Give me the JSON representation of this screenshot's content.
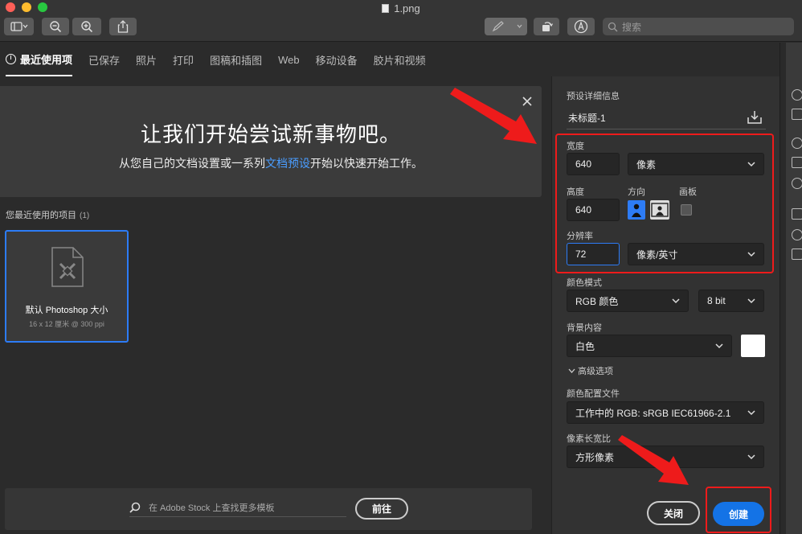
{
  "window": {
    "filename": "1.png"
  },
  "toolbar": {
    "search_placeholder": "搜索"
  },
  "tabs": [
    {
      "label": "最近使用项",
      "active": true
    },
    {
      "label": "已保存"
    },
    {
      "label": "照片"
    },
    {
      "label": "打印"
    },
    {
      "label": "图稿和插图"
    },
    {
      "label": "Web"
    },
    {
      "label": "移动设备"
    },
    {
      "label": "胶片和视频"
    }
  ],
  "hero": {
    "title": "让我们开始尝试新事物吧。",
    "sub_before": "从您自己的文档设置或一系列",
    "sub_link": "文档预设",
    "sub_after": "开始以快速开始工作。"
  },
  "recent": {
    "label": "您最近使用的项目",
    "count": "(1)",
    "items": [
      {
        "name": "默认 Photoshop 大小",
        "desc": "16 x 12 厘米 @ 300 ppi"
      }
    ]
  },
  "stock": {
    "placeholder": "在 Adobe Stock 上查找更多模板",
    "go_label": "前往"
  },
  "preset": {
    "section_label": "预设详细信息",
    "doc_title": "未标题-1",
    "width_label": "宽度",
    "width_value": "640",
    "width_unit": "像素",
    "height_label": "高度",
    "height_value": "640",
    "orientation_label": "方向",
    "artboard_label": "画板",
    "resolution_label": "分辨率",
    "resolution_value": "72",
    "resolution_unit": "像素/英寸",
    "color_mode_label": "颜色模式",
    "color_mode_value": "RGB 颜色",
    "bit_depth_value": "8 bit",
    "background_label": "背景内容",
    "background_value": "白色",
    "background_color": "#ffffff",
    "advanced_label": "高级选项",
    "color_profile_label": "颜色配置文件",
    "color_profile_value": "工作中的 RGB: sRGB IEC61966-2.1",
    "pixel_aspect_label": "像素长宽比",
    "pixel_aspect_value": "方形像素",
    "close_label": "关闭",
    "create_label": "创建"
  },
  "colors": {
    "accent": "#2d7cf6",
    "create": "#1473e6",
    "annotation": "#ee1b1b"
  }
}
